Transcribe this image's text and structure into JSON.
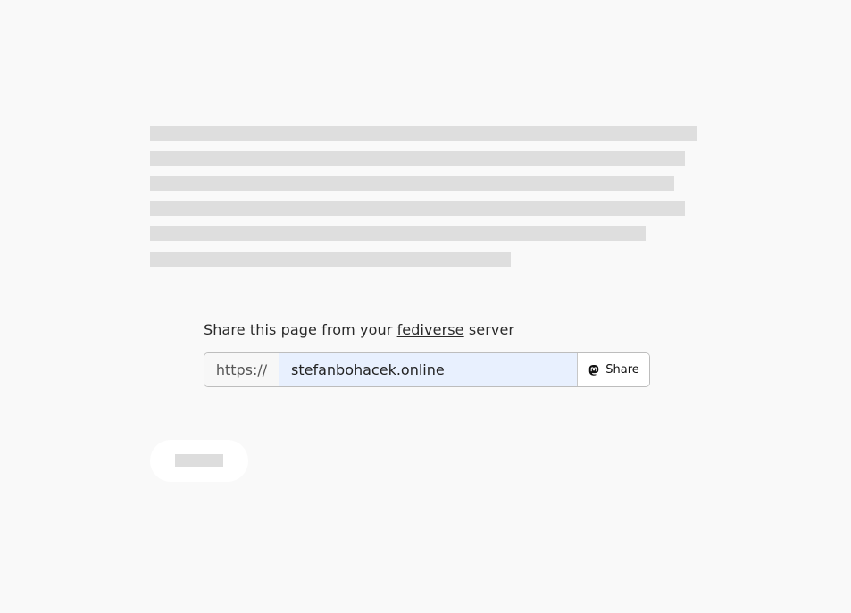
{
  "skeleton": {
    "lines": [
      1,
      2,
      3,
      4,
      5,
      6
    ]
  },
  "share": {
    "prompt_before": "Share this page from your",
    "prompt_link": "fediverse",
    "prompt_after": "server",
    "prefix": "https://",
    "server_value": "stefanbohacek.online",
    "button_label": "Share",
    "button_icon": "mastodon-icon",
    "input_bg": "#e8f0fe"
  },
  "pill_button": {
    "style": "placeholder"
  }
}
